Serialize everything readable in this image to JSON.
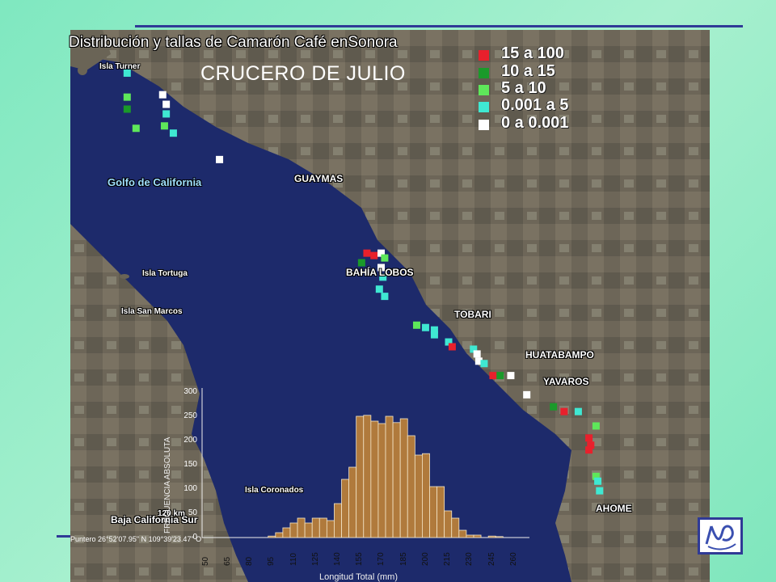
{
  "titles": {
    "main": "Distribución y tallas de Camarón Café enSonora",
    "cruise": "CRUCERO DE JULIO"
  },
  "legend": [
    {
      "label": "15 a 100",
      "color": "#e8202c"
    },
    {
      "label": "10 a 15",
      "color": "#1a9a2a"
    },
    {
      "label": "5 a 10",
      "color": "#5ee85a"
    },
    {
      "label": "0.001 a 5",
      "color": "#3fe8d2"
    },
    {
      "label": "0 a 0.001",
      "color": "#ffffff"
    }
  ],
  "places": {
    "isla_turner": "Isla Turner",
    "golfo": "Golfo de California",
    "guaymas": "GUAYMAS",
    "bahia_lobos": "BAHÍA LOBOS",
    "tobari": "TOBARI",
    "huatabampo": "HUATABAMPO",
    "yavaros": "YAVAROS",
    "ahome": "AHOME",
    "isla_tortuga": "Isla Tortuga",
    "isla_san_marcos": "Isla San Marcos",
    "isla_coronados": "Isla Coronados",
    "baja": "Baja California Sur",
    "scale": "120 km",
    "status": "Puntero  26°52'07.95\" N    109°39'23.47\" O"
  },
  "stations": [
    {
      "lon": -112.28,
      "lat": 28.62,
      "cls": "0.001 a 5"
    },
    {
      "lon": -112.28,
      "lat": 28.52,
      "cls": "5 a 10"
    },
    {
      "lon": -112.28,
      "lat": 28.47,
      "cls": "10 a 15"
    },
    {
      "lon": -112.08,
      "lat": 28.53,
      "cls": "0 a 0.001"
    },
    {
      "lon": -112.06,
      "lat": 28.49,
      "cls": "0 a 0.001"
    },
    {
      "lon": -112.06,
      "lat": 28.45,
      "cls": "0.001 a 5"
    },
    {
      "lon": -112.07,
      "lat": 28.4,
      "cls": "5 a 10"
    },
    {
      "lon": -112.23,
      "lat": 28.39,
      "cls": "5 a 10"
    },
    {
      "lon": -112.02,
      "lat": 28.37,
      "cls": "0.001 a 5"
    },
    {
      "lon": -111.76,
      "lat": 28.26,
      "cls": "0 a 0.001"
    },
    {
      "lon": -110.93,
      "lat": 27.87,
      "cls": "15 a 100"
    },
    {
      "lon": -110.89,
      "lat": 27.86,
      "cls": "15 a 100"
    },
    {
      "lon": -110.85,
      "lat": 27.87,
      "cls": "0 a 0.001"
    },
    {
      "lon": -110.83,
      "lat": 27.85,
      "cls": "5 a 10"
    },
    {
      "lon": -110.96,
      "lat": 27.83,
      "cls": "10 a 15"
    },
    {
      "lon": -110.85,
      "lat": 27.81,
      "cls": "0 a 0.001"
    },
    {
      "lon": -110.84,
      "lat": 27.77,
      "cls": "0.001 a 5"
    },
    {
      "lon": -110.86,
      "lat": 27.72,
      "cls": "0.001 a 5"
    },
    {
      "lon": -110.83,
      "lat": 27.69,
      "cls": "0.001 a 5"
    },
    {
      "lon": -110.65,
      "lat": 27.57,
      "cls": "5 a 10"
    },
    {
      "lon": -110.6,
      "lat": 27.56,
      "cls": "0.001 a 5"
    },
    {
      "lon": -110.55,
      "lat": 27.55,
      "cls": "0.001 a 5"
    },
    {
      "lon": -110.55,
      "lat": 27.53,
      "cls": "0.001 a 5"
    },
    {
      "lon": -110.47,
      "lat": 27.5,
      "cls": "0.001 a 5"
    },
    {
      "lon": -110.45,
      "lat": 27.48,
      "cls": "15 a 100"
    },
    {
      "lon": -110.33,
      "lat": 27.47,
      "cls": "0.001 a 5"
    },
    {
      "lon": -110.31,
      "lat": 27.45,
      "cls": "0 a 0.001"
    },
    {
      "lon": -110.3,
      "lat": 27.42,
      "cls": "0 a 0.001"
    },
    {
      "lon": -110.27,
      "lat": 27.41,
      "cls": "0.001 a 5"
    },
    {
      "lon": -110.22,
      "lat": 27.36,
      "cls": "15 a 100"
    },
    {
      "lon": -110.18,
      "lat": 27.36,
      "cls": "10 a 15"
    },
    {
      "lon": -110.12,
      "lat": 27.36,
      "cls": "0 a 0.001"
    },
    {
      "lon": -110.03,
      "lat": 27.28,
      "cls": "0 a 0.001"
    },
    {
      "lon": -109.88,
      "lat": 27.23,
      "cls": "10 a 15"
    },
    {
      "lon": -109.82,
      "lat": 27.21,
      "cls": "15 a 100"
    },
    {
      "lon": -109.74,
      "lat": 27.21,
      "cls": "0.001 a 5"
    },
    {
      "lon": -109.64,
      "lat": 27.15,
      "cls": "5 a 10"
    },
    {
      "lon": -109.68,
      "lat": 27.1,
      "cls": "15 a 100"
    },
    {
      "lon": -109.67,
      "lat": 27.07,
      "cls": "15 a 100"
    },
    {
      "lon": -109.68,
      "lat": 27.05,
      "cls": "15 a 100"
    },
    {
      "lon": -109.64,
      "lat": 26.94,
      "cls": "5 a 10"
    },
    {
      "lon": -109.63,
      "lat": 26.92,
      "cls": "0.001 a 5"
    },
    {
      "lon": -109.62,
      "lat": 26.88,
      "cls": "0.001 a 5"
    }
  ],
  "chart_data": {
    "type": "bar",
    "title": "",
    "xlabel": "Longitud Total (mm)",
    "ylabel": "FRECUENCIA ABSOLUTA",
    "ylim": [
      0,
      300
    ],
    "yticks": [
      0,
      50,
      100,
      150,
      200,
      250,
      300
    ],
    "xticks": [
      50,
      65,
      80,
      95,
      110,
      125,
      140,
      155,
      170,
      185,
      200,
      215,
      230,
      245,
      260
    ],
    "series": [
      {
        "x": [
          50,
          55,
          60,
          65,
          70,
          75,
          80,
          85,
          90,
          95,
          100,
          105,
          110,
          115,
          120,
          125,
          130,
          135,
          140,
          145,
          150,
          155,
          160,
          165,
          170,
          175,
          180,
          185,
          190,
          195,
          200,
          205,
          210,
          215,
          220,
          225,
          230,
          235,
          240,
          245,
          250,
          255,
          260
        ],
        "values": [
          0,
          0,
          0,
          0,
          0,
          0,
          0,
          0,
          0,
          3,
          10,
          20,
          30,
          40,
          30,
          40,
          40,
          35,
          70,
          120,
          145,
          250,
          252,
          240,
          235,
          250,
          237,
          245,
          210,
          170,
          173,
          105,
          105,
          55,
          40,
          15,
          5,
          5,
          0,
          3,
          2,
          0,
          0
        ]
      }
    ]
  }
}
